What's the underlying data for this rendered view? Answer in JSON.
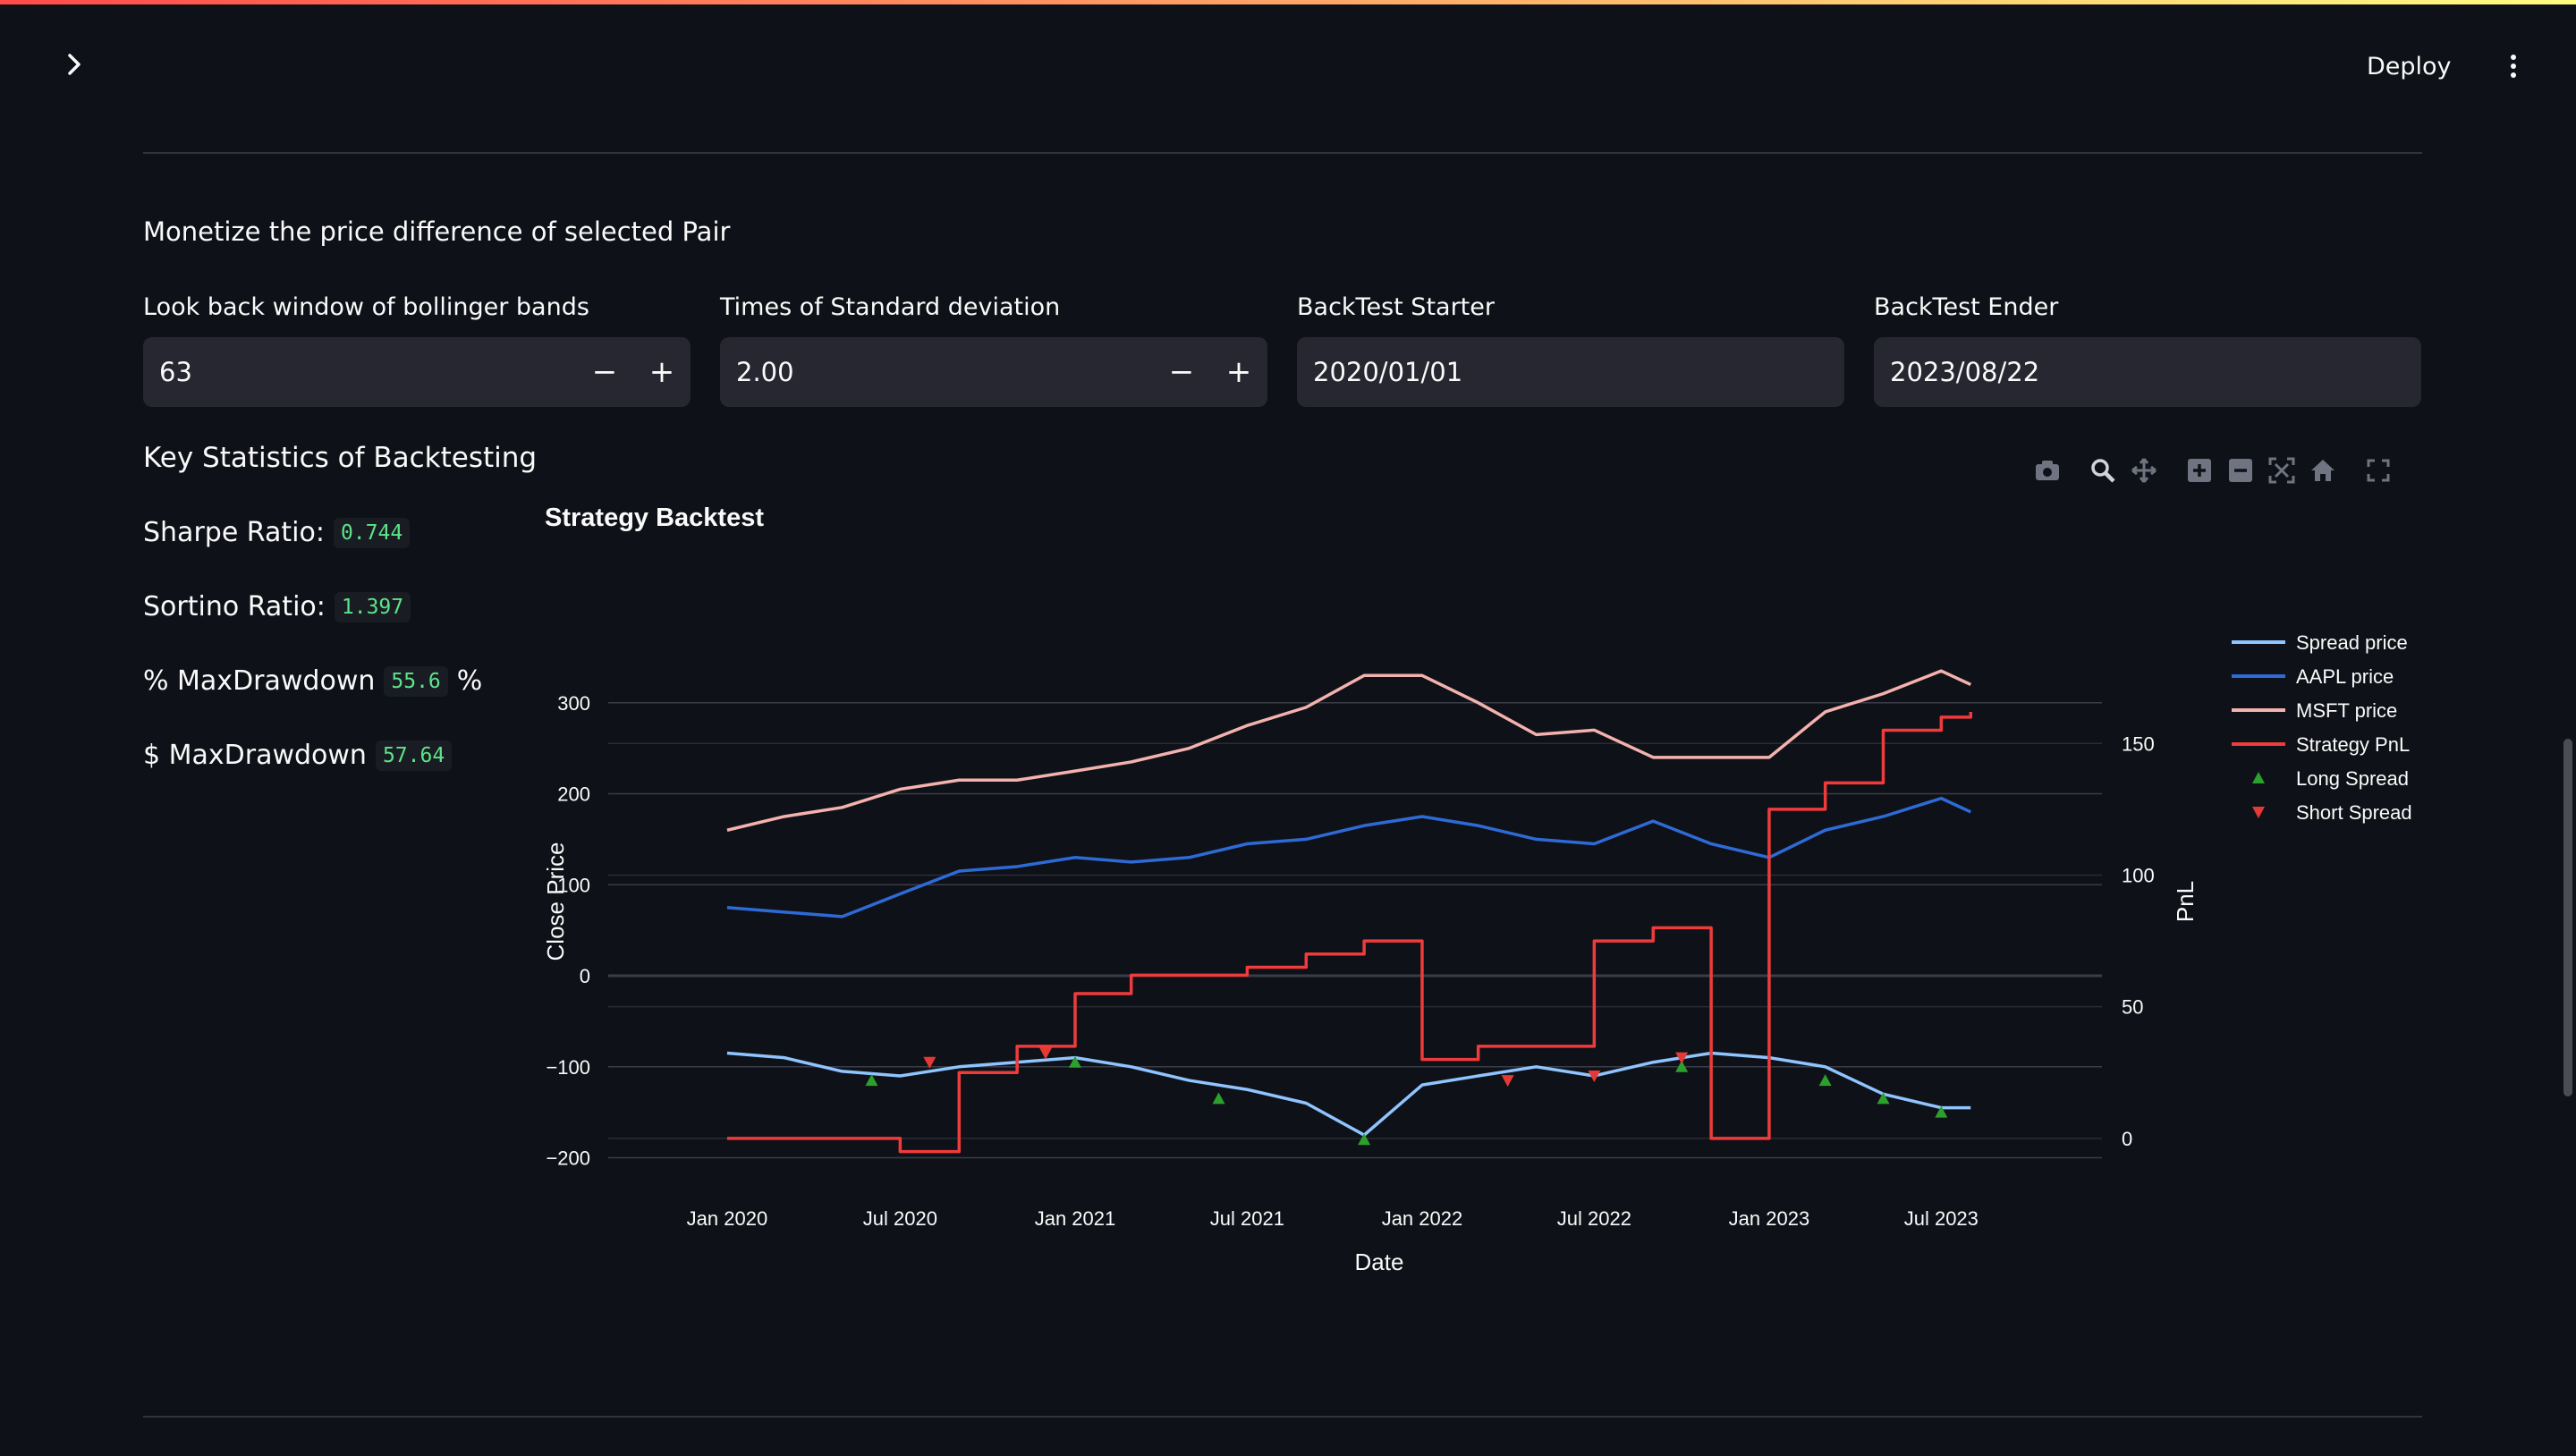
{
  "header": {
    "deploy_label": "Deploy"
  },
  "section": {
    "title": "Monetize the price difference of selected Pair"
  },
  "inputs": {
    "lookback": {
      "label": "Look back window of bollinger bands",
      "value": "63"
    },
    "stddev": {
      "label": "Times of Standard deviation",
      "value": "2.00"
    },
    "start": {
      "label": "BackTest Starter",
      "value": "2020/01/01"
    },
    "end": {
      "label": "BackTest Ender",
      "value": "2023/08/22"
    }
  },
  "stats": {
    "title": "Key Statistics of Backtesting",
    "sharpe_label": "Sharpe Ratio:",
    "sharpe_value": "0.744",
    "sortino_label": "Sortino Ratio:",
    "sortino_value": "1.397",
    "mdd_pct_label": "% MaxDrawdown",
    "mdd_pct_value": "55.6",
    "mdd_pct_suffix": "%",
    "mdd_usd_label": "$ MaxDrawdown",
    "mdd_usd_value": "57.64"
  },
  "modebar_icons": [
    "camera-icon",
    "zoom-icon",
    "pan-icon",
    "zoom-in-icon",
    "zoom-out-icon",
    "autoscale-icon",
    "reset-axes-icon",
    "fullscreen-icon"
  ],
  "colors": {
    "spread": "#8fc4ff",
    "aapl": "#2e6ad6",
    "msft": "#f4b2ae",
    "pnl": "#ef3b3b",
    "long": "#2ca02c",
    "short": "#e53935",
    "accent": "#ff4b4b"
  },
  "chart_data": {
    "type": "line",
    "title": "Strategy Backtest",
    "xlabel": "Date",
    "ylabel": "Close Price",
    "y2label": "PnL",
    "ylim": [
      -225,
      345
    ],
    "y2lim": [
      -16,
      181
    ],
    "yticks": [
      300,
      200,
      100,
      0,
      -100,
      -200
    ],
    "y2ticks": [
      150,
      100,
      50,
      0
    ],
    "xticks": [
      "Jan 2020",
      "Jul 2020",
      "Jan 2021",
      "Jul 2021",
      "Jan 2022",
      "Jul 2022",
      "Jan 2023",
      "Jul 2023"
    ],
    "x_dates": [
      "2020-01",
      "2020-03",
      "2020-05",
      "2020-07",
      "2020-09",
      "2020-11",
      "2021-01",
      "2021-03",
      "2021-05",
      "2021-07",
      "2021-09",
      "2021-11",
      "2022-01",
      "2022-03",
      "2022-05",
      "2022-07",
      "2022-09",
      "2022-11",
      "2023-01",
      "2023-03",
      "2023-05",
      "2023-07",
      "2023-08"
    ],
    "grid": true,
    "legend": "top-right",
    "series": [
      {
        "name": "Spread price",
        "axis": "y",
        "values": [
          -85,
          -90,
          -105,
          -110,
          -100,
          -95,
          -90,
          -100,
          -115,
          -125,
          -140,
          -175,
          -120,
          -110,
          -100,
          -110,
          -95,
          -85,
          -90,
          -100,
          -130,
          -145,
          -145
        ]
      },
      {
        "name": "AAPL price",
        "axis": "y",
        "values": [
          75,
          70,
          65,
          90,
          115,
          120,
          130,
          125,
          130,
          145,
          150,
          165,
          175,
          165,
          150,
          145,
          170,
          145,
          130,
          160,
          175,
          195,
          180
        ]
      },
      {
        "name": "MSFT price",
        "axis": "y",
        "values": [
          160,
          175,
          185,
          205,
          215,
          215,
          225,
          235,
          250,
          275,
          295,
          330,
          330,
          300,
          265,
          270,
          240,
          240,
          240,
          290,
          310,
          335,
          320
        ]
      },
      {
        "name": "Strategy PnL",
        "axis": "y2",
        "values": [
          0,
          0,
          0,
          -5,
          25,
          35,
          55,
          62,
          62,
          65,
          70,
          75,
          30,
          35,
          35,
          75,
          80,
          0,
          125,
          135,
          155,
          160,
          162
        ]
      }
    ],
    "markers": [
      {
        "name": "Long Spread",
        "symbol": "triangle-up",
        "dates": [
          "2020-06",
          "2021-01",
          "2021-06",
          "2021-11",
          "2022-10",
          "2023-03",
          "2023-05",
          "2023-07"
        ],
        "values": [
          -115,
          -95,
          -135,
          -180,
          -100,
          -115,
          -135,
          -150
        ]
      },
      {
        "name": "Short Spread",
        "symbol": "triangle-down",
        "dates": [
          "2020-08",
          "2020-12",
          "2022-04",
          "2022-07",
          "2022-10"
        ],
        "values": [
          -95,
          -85,
          -115,
          -110,
          -90
        ]
      }
    ]
  }
}
